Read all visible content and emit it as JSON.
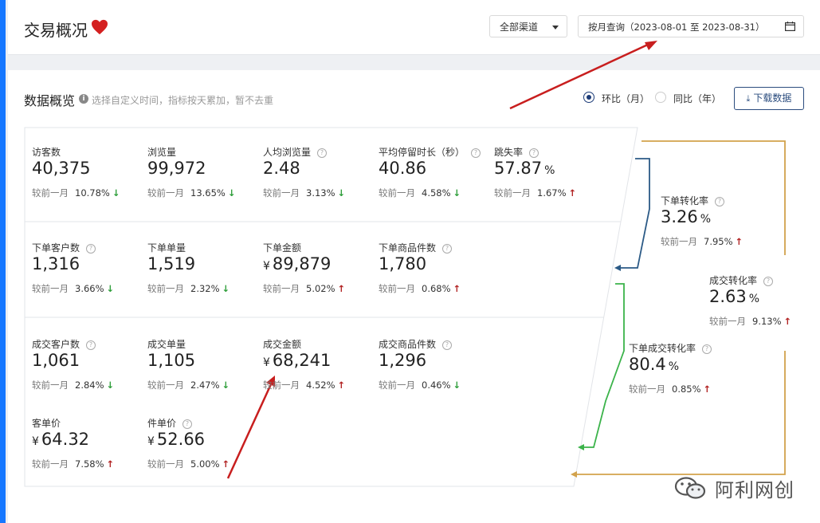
{
  "header": {
    "title": "交易概况",
    "channel_select": "全部渠道",
    "date_range": "按月查询（2023-08-01 至 2023-08-31）"
  },
  "overview": {
    "title": "数据概览",
    "hint": "选择自定义时间，指标按天累加，暂不去重",
    "mom_label": "环比（月）",
    "yoy_label": "同比（年）",
    "download_label": "下载数据"
  },
  "compare_label": "较前一月",
  "metrics": [
    {
      "id": "visitors",
      "label": "访客数",
      "value": "40,375",
      "change": "10.78%",
      "dir": "down",
      "help": false
    },
    {
      "id": "pageviews",
      "label": "浏览量",
      "value": "99,972",
      "change": "13.65%",
      "dir": "down",
      "help": false
    },
    {
      "id": "pv-per-visitor",
      "label": "人均浏览量",
      "value": "2.48",
      "change": "3.13%",
      "dir": "down",
      "help": true
    },
    {
      "id": "avg-stay",
      "label": "平均停留时长（秒）",
      "value": "40.86",
      "change": "4.58%",
      "dir": "down",
      "help": true
    },
    {
      "id": "bounce-rate",
      "label": "跳失率",
      "value": "57.87",
      "unit": "%",
      "change": "1.67%",
      "dir": "up",
      "help": true
    },
    {
      "id": "order-customers",
      "label": "下单客户数",
      "value": "1,316",
      "change": "3.66%",
      "dir": "down",
      "help": true
    },
    {
      "id": "order-count",
      "label": "下单单量",
      "value": "1,519",
      "change": "2.32%",
      "dir": "down",
      "help": false
    },
    {
      "id": "order-amount",
      "label": "下单金额",
      "value": "89,879",
      "currency": "¥",
      "change": "5.02%",
      "dir": "up",
      "help": false
    },
    {
      "id": "order-items",
      "label": "下单商品件数",
      "value": "1,780",
      "change": "0.68%",
      "dir": "up",
      "help": true
    },
    {
      "id": "deal-customers",
      "label": "成交客户数",
      "value": "1,061",
      "change": "2.84%",
      "dir": "down",
      "help": true
    },
    {
      "id": "deal-count",
      "label": "成交单量",
      "value": "1,105",
      "change": "2.47%",
      "dir": "down",
      "help": false
    },
    {
      "id": "deal-amount",
      "label": "成交金额",
      "value": "68,241",
      "currency": "¥",
      "change": "4.52%",
      "dir": "up",
      "help": false
    },
    {
      "id": "deal-items",
      "label": "成交商品件数",
      "value": "1,296",
      "change": "0.46%",
      "dir": "down",
      "help": true
    },
    {
      "id": "avg-order-value",
      "label": "客单价",
      "value": "64.32",
      "currency": "¥",
      "change": "7.58%",
      "dir": "up",
      "help": false
    },
    {
      "id": "avg-item-price",
      "label": "件单价",
      "value": "52.66",
      "currency": "¥",
      "change": "5.00%",
      "dir": "up",
      "help": true
    },
    {
      "id": "order-conv",
      "label": "下单转化率",
      "value": "3.26",
      "unit": "%",
      "change": "7.95%",
      "dir": "up",
      "help": true
    },
    {
      "id": "deal-conv",
      "label": "成交转化率",
      "value": "2.63",
      "unit": "%",
      "change": "9.13%",
      "dir": "up",
      "help": true
    },
    {
      "id": "order-deal-conv",
      "label": "下单成交转化率",
      "value": "80.4",
      "unit": "%",
      "change": "0.85%",
      "dir": "up",
      "help": true
    }
  ],
  "watermark": "阿利网创",
  "colors": {
    "up": "#b22323",
    "down": "#2e9e3a",
    "funnel_orange": "#d2a24c",
    "funnel_blue": "#2b5a86",
    "funnel_green": "#3bb34a",
    "annotation_arrow": "#c81e1e"
  }
}
